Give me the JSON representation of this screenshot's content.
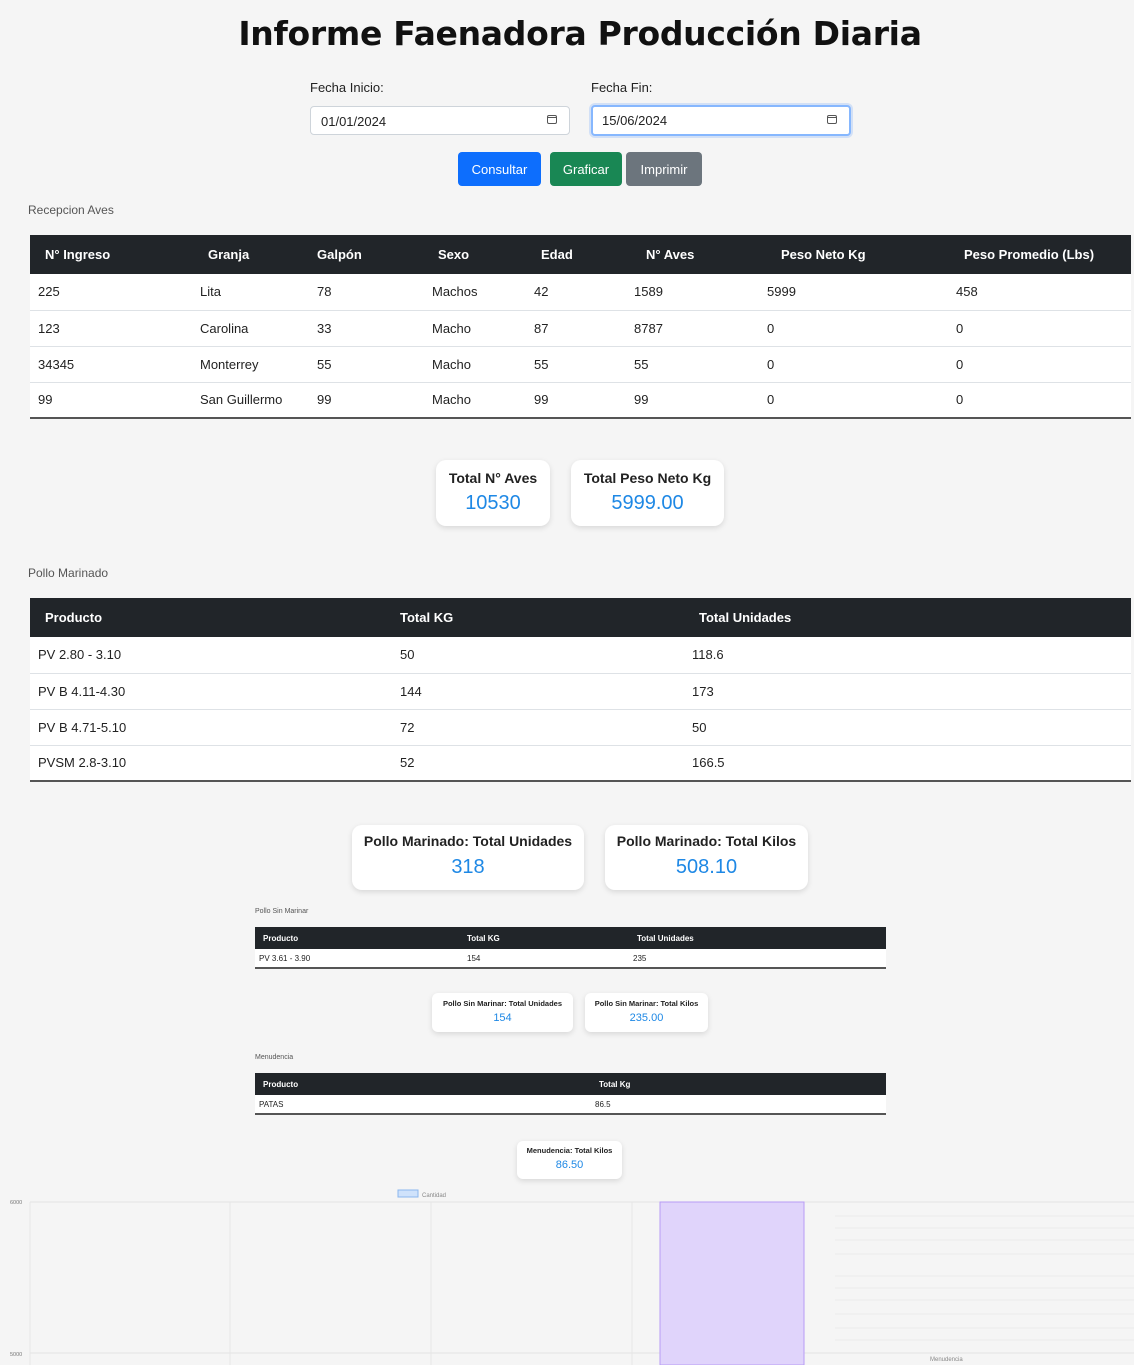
{
  "page_title": "Informe Faenadora Producción Diaria",
  "filters": {
    "start_label": "Fecha Inicio:",
    "start_value": "01/01/2024",
    "end_label": "Fecha Fin:",
    "end_value": "15/06/2024"
  },
  "buttons": {
    "consultar": "Consultar",
    "graficar": "Graficar",
    "imprimir": "Imprimir"
  },
  "recepcion": {
    "title": "Recepcion Aves",
    "headers": [
      "N° Ingreso",
      "Granja",
      "Galpón",
      "Sexo",
      "Edad",
      "N° Aves",
      "Peso Neto Kg",
      "Peso Promedio (Lbs)"
    ],
    "rows": [
      [
        "225",
        "Lita",
        "78",
        "Machos",
        "42",
        "1589",
        "5999",
        "458"
      ],
      [
        "123",
        "Carolina",
        "33",
        "Macho",
        "87",
        "8787",
        "0",
        "0"
      ],
      [
        "34345",
        "Monterrey",
        "55",
        "Macho",
        "55",
        "55",
        "0",
        "0"
      ],
      [
        "99",
        "San Guillermo",
        "99",
        "Macho",
        "99",
        "99",
        "0",
        "0"
      ]
    ],
    "total_aves_label": "Total N° Aves",
    "total_aves_value": "10530",
    "total_peso_label": "Total Peso Neto Kg",
    "total_peso_value": "5999.00"
  },
  "marinado": {
    "title": "Pollo Marinado",
    "headers": [
      "Producto",
      "Total KG",
      "Total Unidades"
    ],
    "rows": [
      [
        "PV 2.80 - 3.10",
        "50",
        "118.6"
      ],
      [
        "PV B 4.11-4.30",
        "144",
        "173"
      ],
      [
        "PV B 4.71-5.10",
        "72",
        "50"
      ],
      [
        "PVSM 2.8-3.10",
        "52",
        "166.5"
      ]
    ],
    "total_unidades_label": "Pollo Marinado: Total Unidades",
    "total_unidades_value": "318",
    "total_kilos_label": "Pollo Marinado: Total Kilos",
    "total_kilos_value": "508.10"
  },
  "sin_marinar": {
    "title": "Pollo Sin Marinar",
    "headers": [
      "Producto",
      "Total KG",
      "Total Unidades"
    ],
    "rows": [
      [
        "PV 3.61 - 3.90",
        "154",
        "235"
      ]
    ],
    "total_unidades_label": "Pollo Sin Marinar: Total Unidades",
    "total_unidades_value": "154",
    "total_kilos_label": "Pollo Sin Marinar: Total Kilos",
    "total_kilos_value": "235.00"
  },
  "menudencia": {
    "title": "Menudencia",
    "headers": [
      "Producto",
      "Total Kg"
    ],
    "rows": [
      [
        "PATAS",
        "86.5"
      ]
    ],
    "total_kilos_label": "Menudencia: Total Kilos",
    "total_kilos_value": "86.50"
  },
  "chart_data": {
    "type": "bar",
    "legend": "Cantidad",
    "legend_position": "top",
    "y_ticks": [
      "6000",
      "5000"
    ],
    "x_label_visible": "Menudencia",
    "bar_value": 6000,
    "ylim_visible": [
      5000,
      6000
    ],
    "bar_color": "#e0d4fb",
    "bar_border": "#b79cf5",
    "grid": true
  }
}
